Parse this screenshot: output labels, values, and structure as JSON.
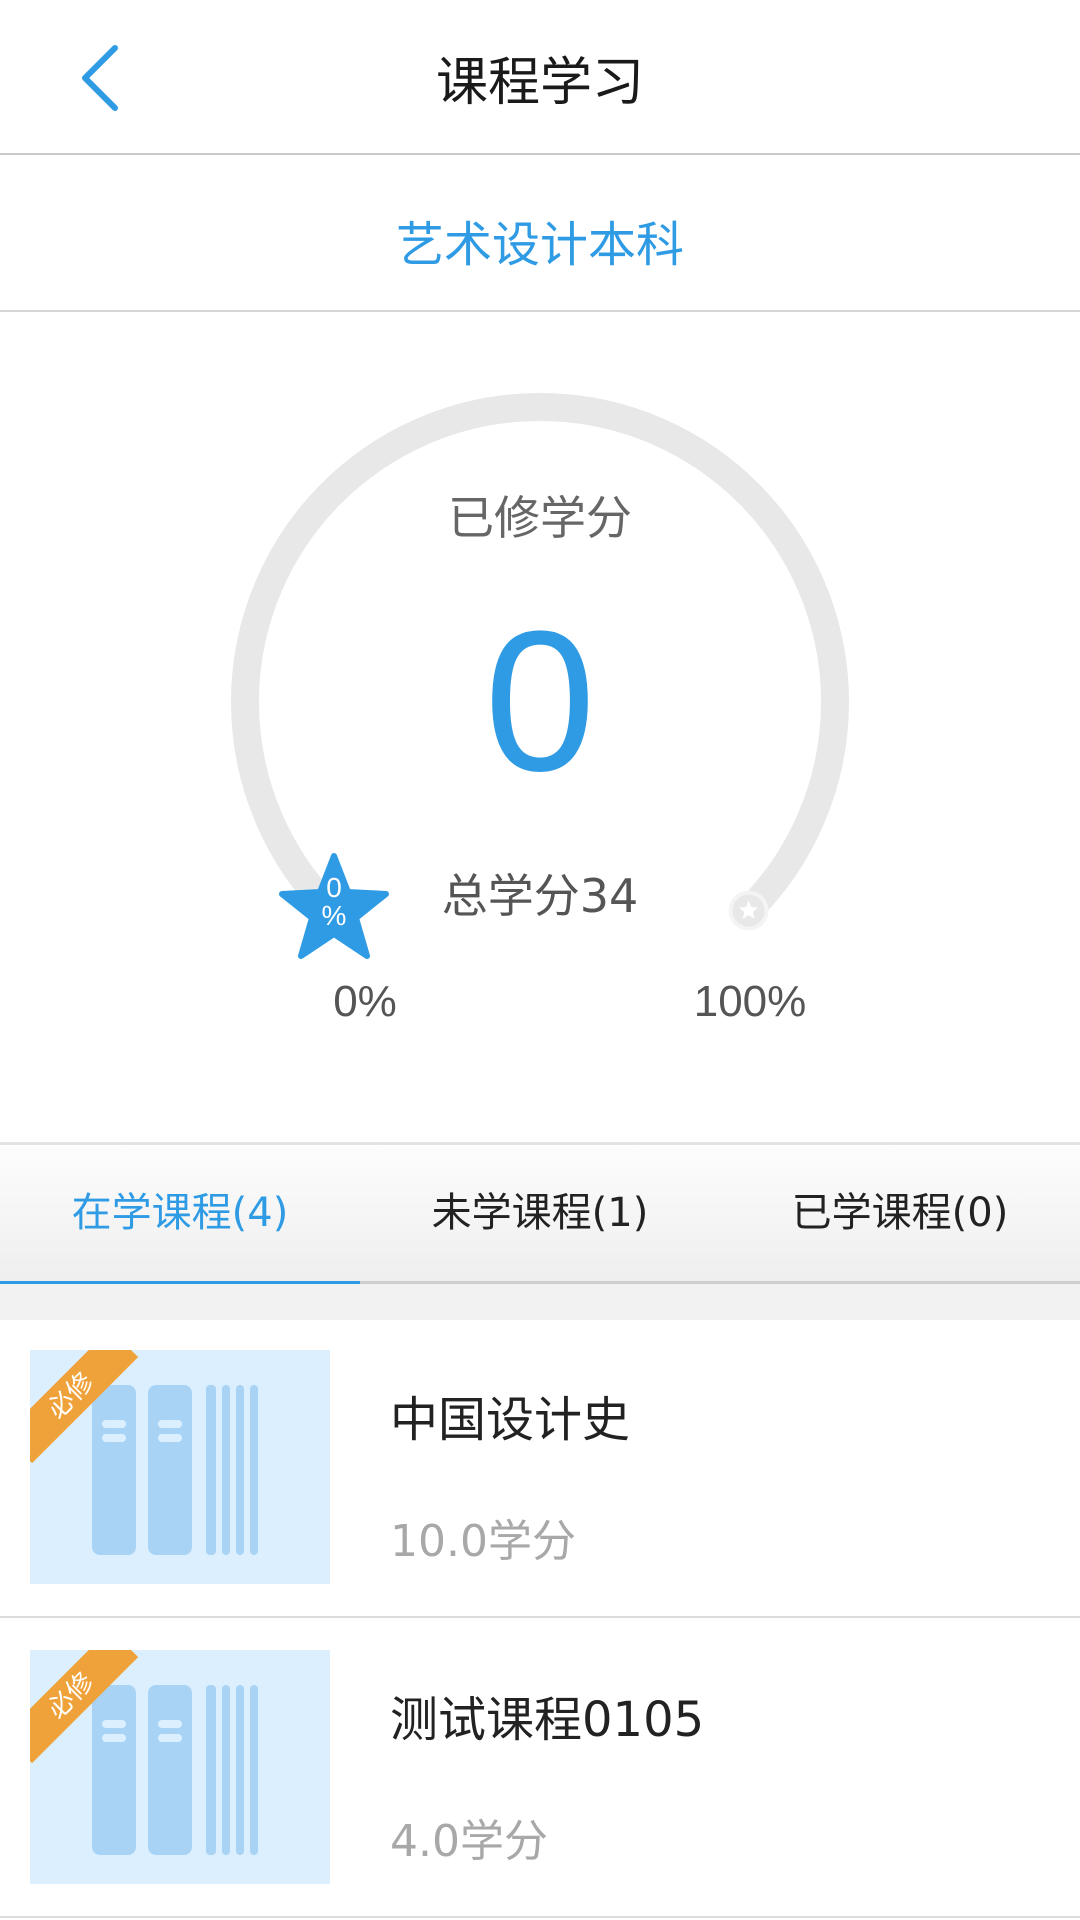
{
  "header": {
    "title": "课程学习",
    "back_icon": "chevron-left-icon"
  },
  "major": {
    "name": "艺术设计本科"
  },
  "credits": {
    "earned_label": "已修学分",
    "earned_value": "0",
    "total_label": "总学分34",
    "progress_percent": 0,
    "marker_text": "0\n%",
    "start_label": "0%",
    "end_label": "100%",
    "accent_color": "#2e9be4"
  },
  "tabs": [
    {
      "label": "在学课程(4)",
      "active": true
    },
    {
      "label": "未学课程(1)",
      "active": false
    },
    {
      "label": "已学课程(0)",
      "active": false
    }
  ],
  "courses": [
    {
      "tag": "必修",
      "name": "中国设计史",
      "credit": "10.0学分"
    },
    {
      "tag": "必修",
      "name": "测试课程0105",
      "credit": "4.0学分"
    }
  ]
}
